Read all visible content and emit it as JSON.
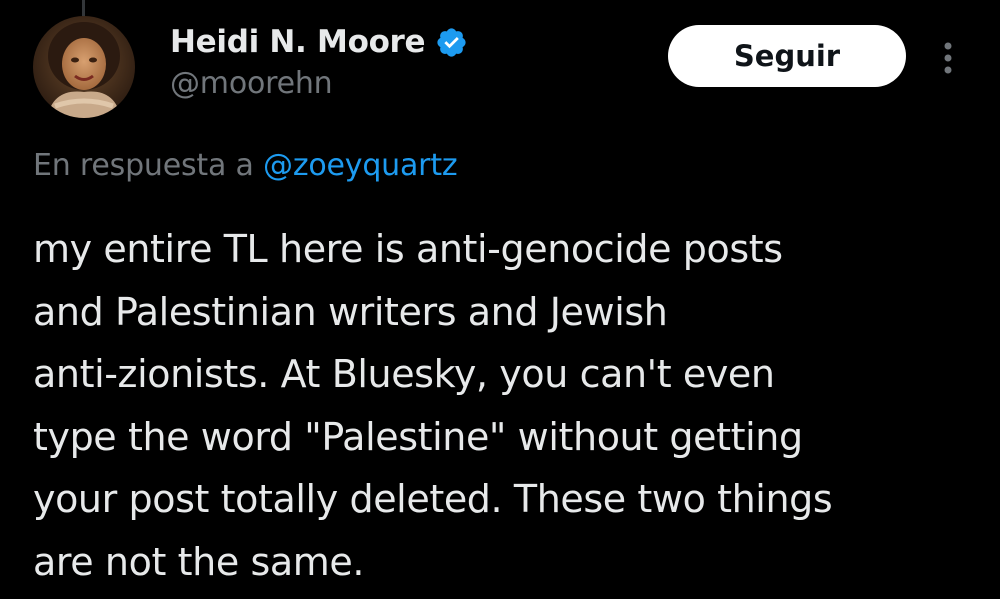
{
  "author": {
    "display_name": "Heidi N. Moore",
    "handle": "@moorehn",
    "verified": true,
    "avatar_icon": "profile-photo"
  },
  "actions": {
    "follow_label": "Seguir",
    "more_icon": "vertical-ellipsis-icon"
  },
  "reply": {
    "prefix": "En respuesta a",
    "to_handle": "@zoeyquartz"
  },
  "tweet": {
    "lines": [
      "my entire TL here is anti-genocide posts",
      "and Palestinian writers and Jewish",
      "anti-zionists. At Bluesky, you can't even",
      "type the word \"Palestine\" without getting",
      "your post totally deleted. These two things",
      "are not the same."
    ]
  },
  "colors": {
    "background": "#000000",
    "text_primary": "#e7e9ea",
    "text_secondary": "#71767b",
    "accent": "#1d9bf0",
    "follow_button_bg": "#ffffff",
    "follow_button_text": "#0f1419"
  }
}
